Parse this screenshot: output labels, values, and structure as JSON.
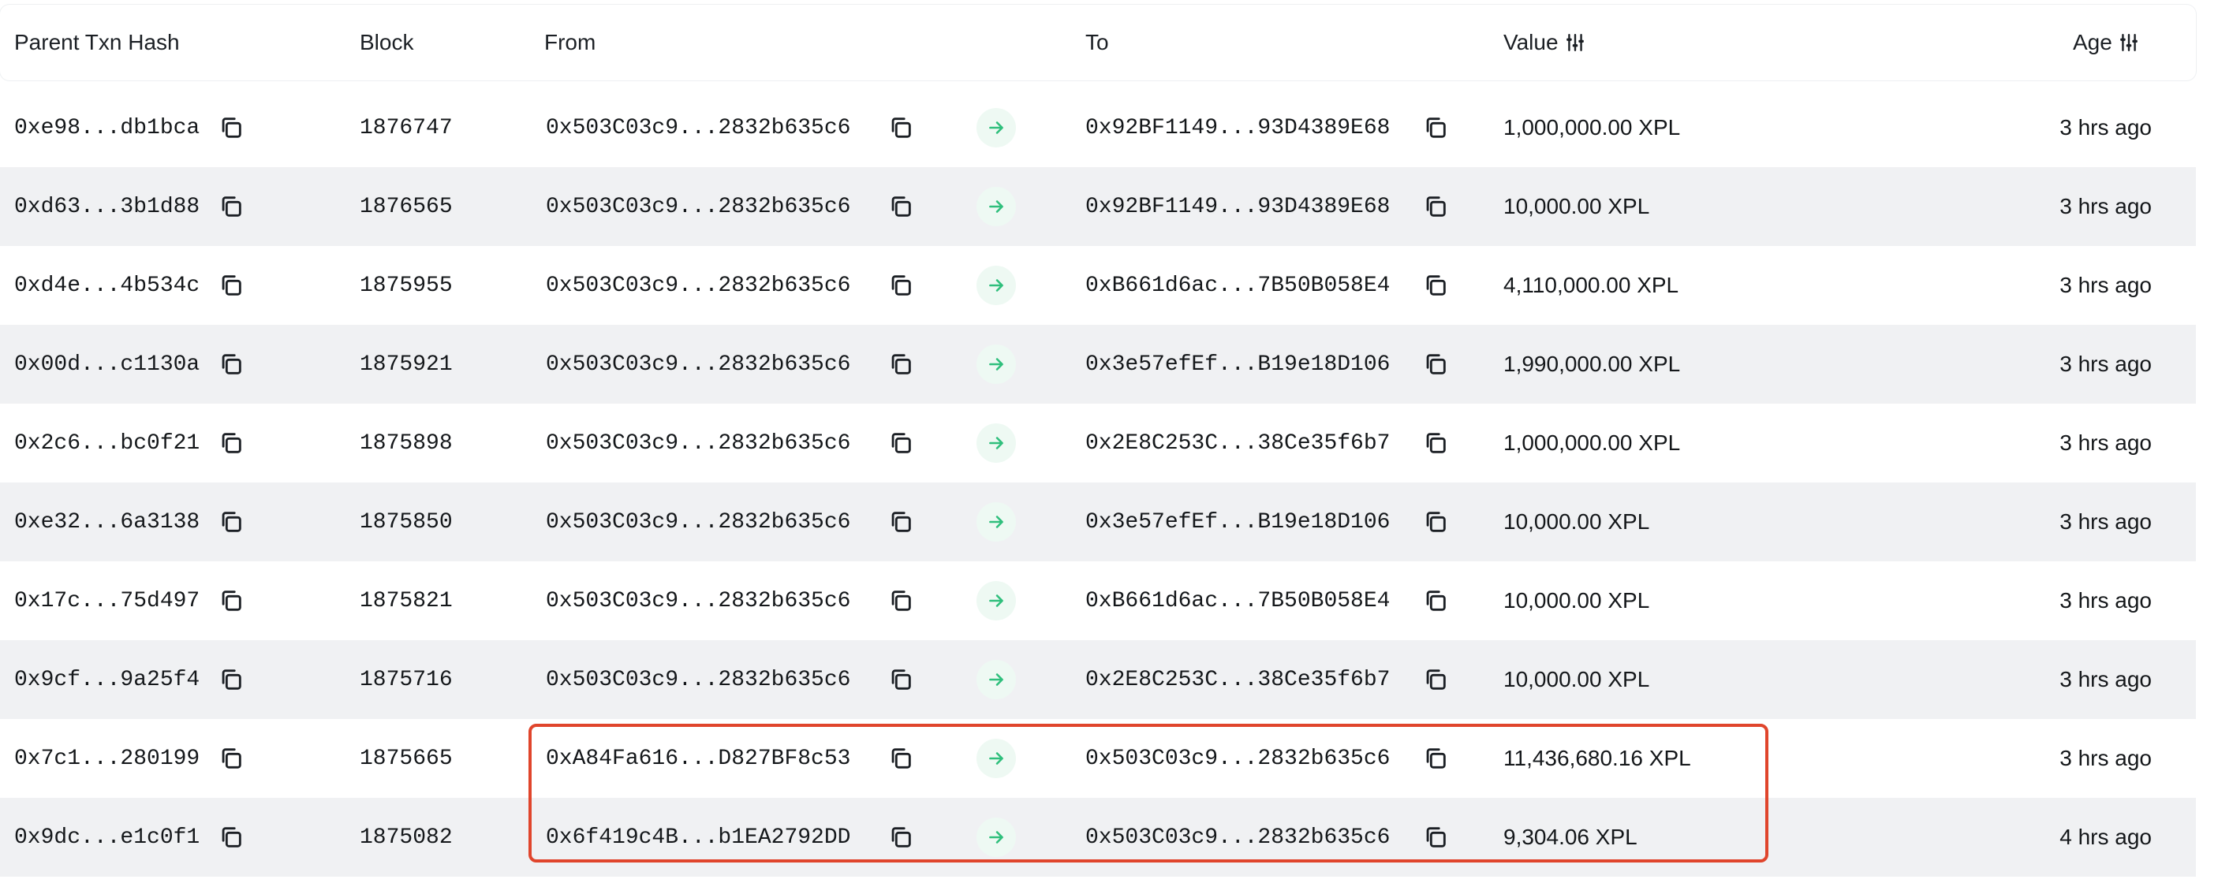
{
  "columns": {
    "parent_txn_hash": "Parent Txn Hash",
    "block": "Block",
    "from": "From",
    "to": "To",
    "value": "Value",
    "age": "Age"
  },
  "icons": {
    "copy": "copy-icon",
    "arrow": "arrow-right-icon",
    "filter": "filter-icon"
  },
  "colors": {
    "accent_green": "#2fbf7c",
    "highlight_red": "#e0452c",
    "row_alt": "#f0f1f3"
  },
  "rows": [
    {
      "hash": "0xe98...db1bca",
      "block": "1876747",
      "from": "0x503C03c9...2832b635c6",
      "to": "0x92BF1149...93D4389E68",
      "value": "1,000,000.00 XPL",
      "age": "3 hrs ago"
    },
    {
      "hash": "0xd63...3b1d88",
      "block": "1876565",
      "from": "0x503C03c9...2832b635c6",
      "to": "0x92BF1149...93D4389E68",
      "value": "10,000.00 XPL",
      "age": "3 hrs ago"
    },
    {
      "hash": "0xd4e...4b534c",
      "block": "1875955",
      "from": "0x503C03c9...2832b635c6",
      "to": "0xB661d6ac...7B50B058E4",
      "value": "4,110,000.00 XPL",
      "age": "3 hrs ago"
    },
    {
      "hash": "0x00d...c1130a",
      "block": "1875921",
      "from": "0x503C03c9...2832b635c6",
      "to": "0x3e57efEf...B19e18D106",
      "value": "1,990,000.00 XPL",
      "age": "3 hrs ago"
    },
    {
      "hash": "0x2c6...bc0f21",
      "block": "1875898",
      "from": "0x503C03c9...2832b635c6",
      "to": "0x2E8C253C...38Ce35f6b7",
      "value": "1,000,000.00 XPL",
      "age": "3 hrs ago"
    },
    {
      "hash": "0xe32...6a3138",
      "block": "1875850",
      "from": "0x503C03c9...2832b635c6",
      "to": "0x3e57efEf...B19e18D106",
      "value": "10,000.00 XPL",
      "age": "3 hrs ago"
    },
    {
      "hash": "0x17c...75d497",
      "block": "1875821",
      "from": "0x503C03c9...2832b635c6",
      "to": "0xB661d6ac...7B50B058E4",
      "value": "10,000.00 XPL",
      "age": "3 hrs ago"
    },
    {
      "hash": "0x9cf...9a25f4",
      "block": "1875716",
      "from": "0x503C03c9...2832b635c6",
      "to": "0x2E8C253C...38Ce35f6b7",
      "value": "10,000.00 XPL",
      "age": "3 hrs ago"
    },
    {
      "hash": "0x7c1...280199",
      "block": "1875665",
      "from": "0xA84Fa616...D827BF8c53",
      "to": "0x503C03c9...2832b635c6",
      "value": "11,436,680.16 XPL",
      "age": "3 hrs ago"
    },
    {
      "hash": "0x9dc...e1c0f1",
      "block": "1875082",
      "from": "0x6f419c4B...b1EA2792DD",
      "to": "0x503C03c9...2832b635c6",
      "value": "9,304.06 XPL",
      "age": "4 hrs ago"
    }
  ]
}
